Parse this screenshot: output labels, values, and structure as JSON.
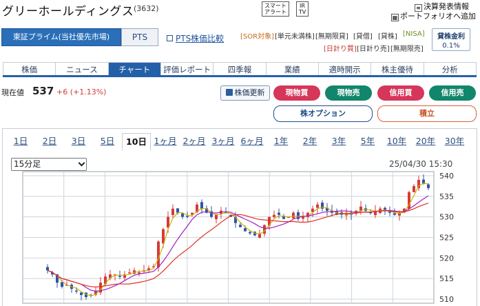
{
  "header": {
    "company_name": "グリーホールディングス",
    "code": "(3632)",
    "smart_alert": [
      "スマート",
      "アラート"
    ],
    "ir_tv": [
      "IR",
      "TV"
    ],
    "earnings_link": "決算発表情報",
    "portfolio_link": "ポートフォリオへ追加"
  },
  "market": {
    "primary": "東証プライム(当社優先市場)",
    "pts": "PTS",
    "pts_compare": "PTS株価比較"
  },
  "tags": {
    "row1": [
      "[SOR対象]",
      "[単元未満株]",
      "[無期限貸]",
      "[貸借]",
      "[貸株]",
      "[NISA]"
    ],
    "row2": [
      "[日計り買]",
      "[日計り売]",
      "[無期限売]"
    ]
  },
  "lending": {
    "label": "貸株金利",
    "rate": "0.1%"
  },
  "tabs": [
    "株価",
    "ニュース",
    "チャート",
    "評価レポート",
    "四季報",
    "業績",
    "適時開示",
    "株主優待",
    "分析"
  ],
  "active_tab": "チャート",
  "price": {
    "label": "現在値",
    "value": "537",
    "change": "+6 (+1.13%)",
    "refresh": "株価更新"
  },
  "trade_buttons": [
    {
      "label": "現物買",
      "kind": "buy"
    },
    {
      "label": "現物売",
      "kind": "sell"
    },
    {
      "label": "信用買",
      "kind": "buy"
    },
    {
      "label": "信用売",
      "kind": "sell"
    }
  ],
  "option_button": "株オプション",
  "accumulate_button": "積立",
  "periods": [
    "1日",
    "2日",
    "3日",
    "5日",
    "10日",
    "1ヶ月",
    "2ヶ月",
    "3ヶ月",
    "6ヶ月",
    "1年",
    "2年",
    "3年",
    "5年",
    "10年",
    "20年",
    "30年"
  ],
  "active_period": "10日",
  "interval": "15分足",
  "datetime": "25/04/30 15:30",
  "colors": {
    "up": "#d63a3a",
    "down": "#2d55a8",
    "ma_short": "#c8b400",
    "ma_mid": "#a020c0",
    "ma_long": "#e03020",
    "tab_active": "#2460a8"
  },
  "chart_data": {
    "type": "candlestick",
    "y_ticks": [
      "540",
      "535",
      "530",
      "525",
      "520",
      "515",
      "510"
    ],
    "ylim": [
      509,
      541
    ],
    "interval": "15min",
    "close_series": [
      517,
      516,
      514,
      513,
      513.5,
      512.5,
      512,
      511,
      510.5,
      511,
      512,
      514,
      515.5,
      516,
      516,
      515.5,
      516,
      516.5,
      517,
      516.5,
      517,
      517.5,
      518,
      524,
      527,
      530,
      532,
      531,
      530,
      530,
      531,
      533,
      532,
      531,
      530,
      530.5,
      531.5,
      531,
      530,
      528.5,
      527.5,
      526.5,
      526,
      525.5,
      526,
      528,
      530,
      530.5,
      530.5,
      529.5,
      530,
      531,
      529.5,
      530,
      531,
      532,
      533,
      532,
      531.5,
      531,
      530.5,
      530.5,
      531,
      530.5,
      531.5,
      532.5,
      531.5,
      531,
      531.5,
      532,
      531.5,
      531,
      530.5,
      531,
      532,
      536,
      537.5,
      539,
      538,
      537
    ]
  }
}
